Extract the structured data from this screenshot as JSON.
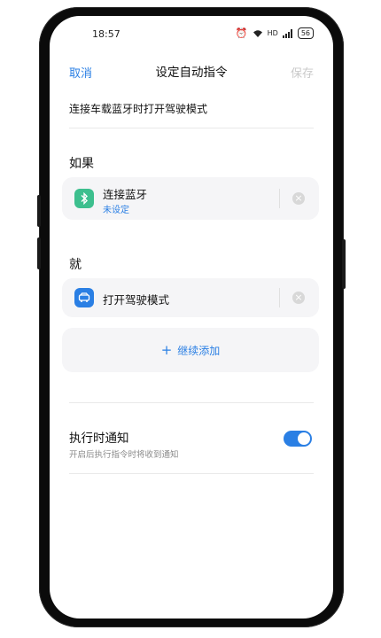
{
  "status_bar": {
    "time": "18:57",
    "network": "HD",
    "battery": "56"
  },
  "header": {
    "cancel_label": "取消",
    "title": "设定自动指令",
    "save_label": "保存"
  },
  "command_name": "连接车载蓝牙时打开驾驶模式",
  "if_section": {
    "label": "如果",
    "condition": {
      "label": "连接蓝牙",
      "status": "未设定",
      "icon": "bluetooth-icon",
      "icon_color": "#3dbf8e"
    }
  },
  "then_section": {
    "label": "就",
    "action": {
      "label": "打开驾驶模式",
      "icon": "car-icon",
      "icon_color": "#2a7fe4"
    },
    "add_label": "继续添加"
  },
  "notify": {
    "title": "执行时通知",
    "description": "开启后执行指令时将收到通知",
    "enabled": true
  },
  "colors": {
    "accent": "#2a7fe4",
    "bluetooth": "#3dbf8e",
    "disabled": "#c9c9c9"
  }
}
